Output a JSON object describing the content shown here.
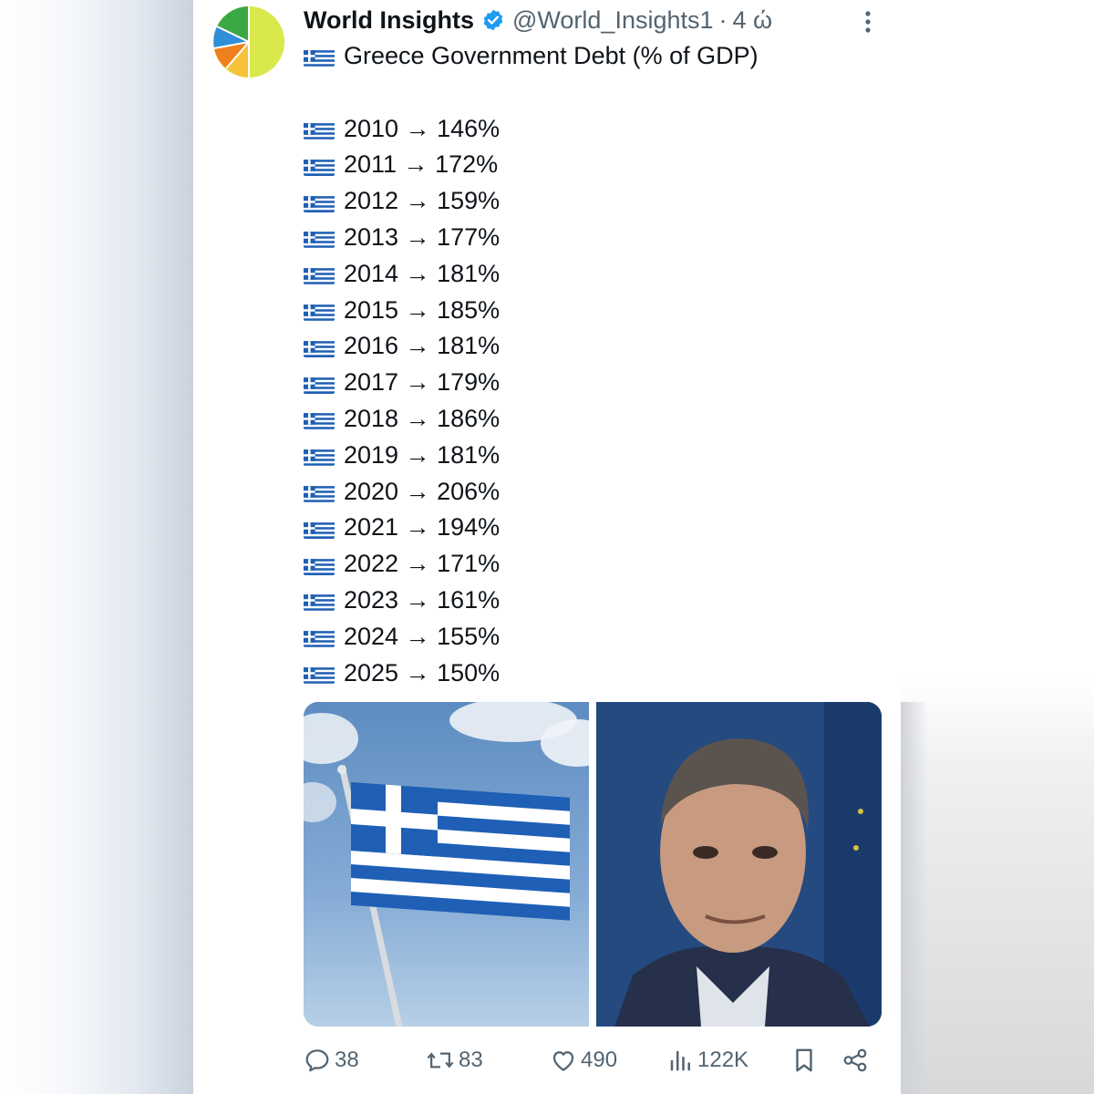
{
  "colors": {
    "text_primary": "#0f1419",
    "text_secondary": "#536471",
    "verified_blue": "#1d9bf0",
    "greek_blue": "#1f5fb5"
  },
  "tweet": {
    "author_name": "World Insights",
    "handle": "@World_Insights1",
    "separator": "·",
    "time": "4 ώ",
    "title": "Greece Government Debt (% of GDP)",
    "entries": [
      {
        "text": "2010 → 146%"
      },
      {
        "text": "2011 → 172%"
      },
      {
        "text": "2012 → 159%"
      },
      {
        "text": "2013 → 177%"
      },
      {
        "text": "2014 → 181%"
      },
      {
        "text": "2015 → 185%"
      },
      {
        "text": "2016 → 181%"
      },
      {
        "text": "2017 → 179%"
      },
      {
        "text": "2018 → 186%"
      },
      {
        "text": "2019 → 181%"
      },
      {
        "text": "2020 → 206%"
      },
      {
        "text": "2021 → 194%"
      },
      {
        "text": "2022 → 171%"
      },
      {
        "text": "2023 → 161%"
      },
      {
        "text": "2024 → 155%"
      },
      {
        "text": "2025 → 150%"
      }
    ]
  },
  "actions": {
    "replies": "38",
    "reposts": "83",
    "likes": "490",
    "views": "122K"
  },
  "icons": {
    "avatar": "pie-chart-logo",
    "verified": "verified-badge-icon",
    "more": "more-options-icon",
    "flag": "greek-flag-emoji",
    "reply": "reply-icon",
    "repost": "repost-icon",
    "like": "heart-icon",
    "views": "views-icon",
    "bookmark": "bookmark-icon",
    "share": "share-icon"
  }
}
